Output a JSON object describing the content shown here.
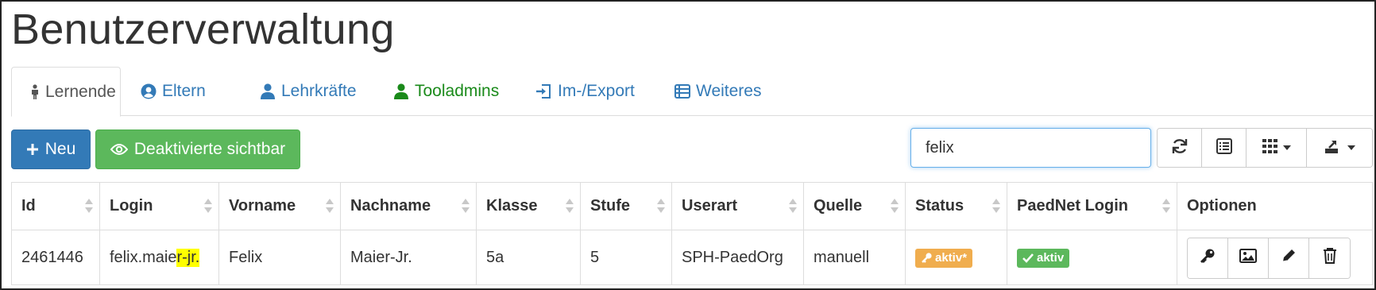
{
  "page": {
    "title": "Benutzerverwaltung"
  },
  "tabs": [
    {
      "label": "Lernende",
      "icon": "child-icon",
      "active": true
    },
    {
      "label": "Eltern",
      "icon": "user-circle-icon"
    },
    {
      "label": "Lehrkräfte",
      "icon": "user-icon"
    },
    {
      "label": "Tooladmins",
      "icon": "user-admin-icon",
      "color": "#1a8a1a"
    },
    {
      "label": "Im-/Export",
      "icon": "import-export-icon"
    },
    {
      "label": "Weiteres",
      "icon": "list-table-icon"
    }
  ],
  "toolbar": {
    "new_label": "Neu",
    "deactivated_label": "Deaktivierte sichtbar",
    "search_value": "felix",
    "colors": {
      "primary": "#337ab7",
      "success": "#5cb85c",
      "warning": "#f0ad4e"
    }
  },
  "table": {
    "columns": [
      "Id",
      "Login",
      "Vorname",
      "Nachname",
      "Klasse",
      "Stufe",
      "Userart",
      "Quelle",
      "Status",
      "PaedNet Login",
      "Optionen"
    ],
    "rows": [
      {
        "id": "2461446",
        "login_prefix": "felix.maie",
        "login_highlight": "r-jr.",
        "vorname": "Felix",
        "nachname": "Maier-Jr.",
        "klasse": "5a",
        "stufe": "5",
        "userart": "SPH-PaedOrg",
        "quelle": "manuell",
        "status": "aktiv*",
        "paednet": "aktiv"
      }
    ]
  }
}
